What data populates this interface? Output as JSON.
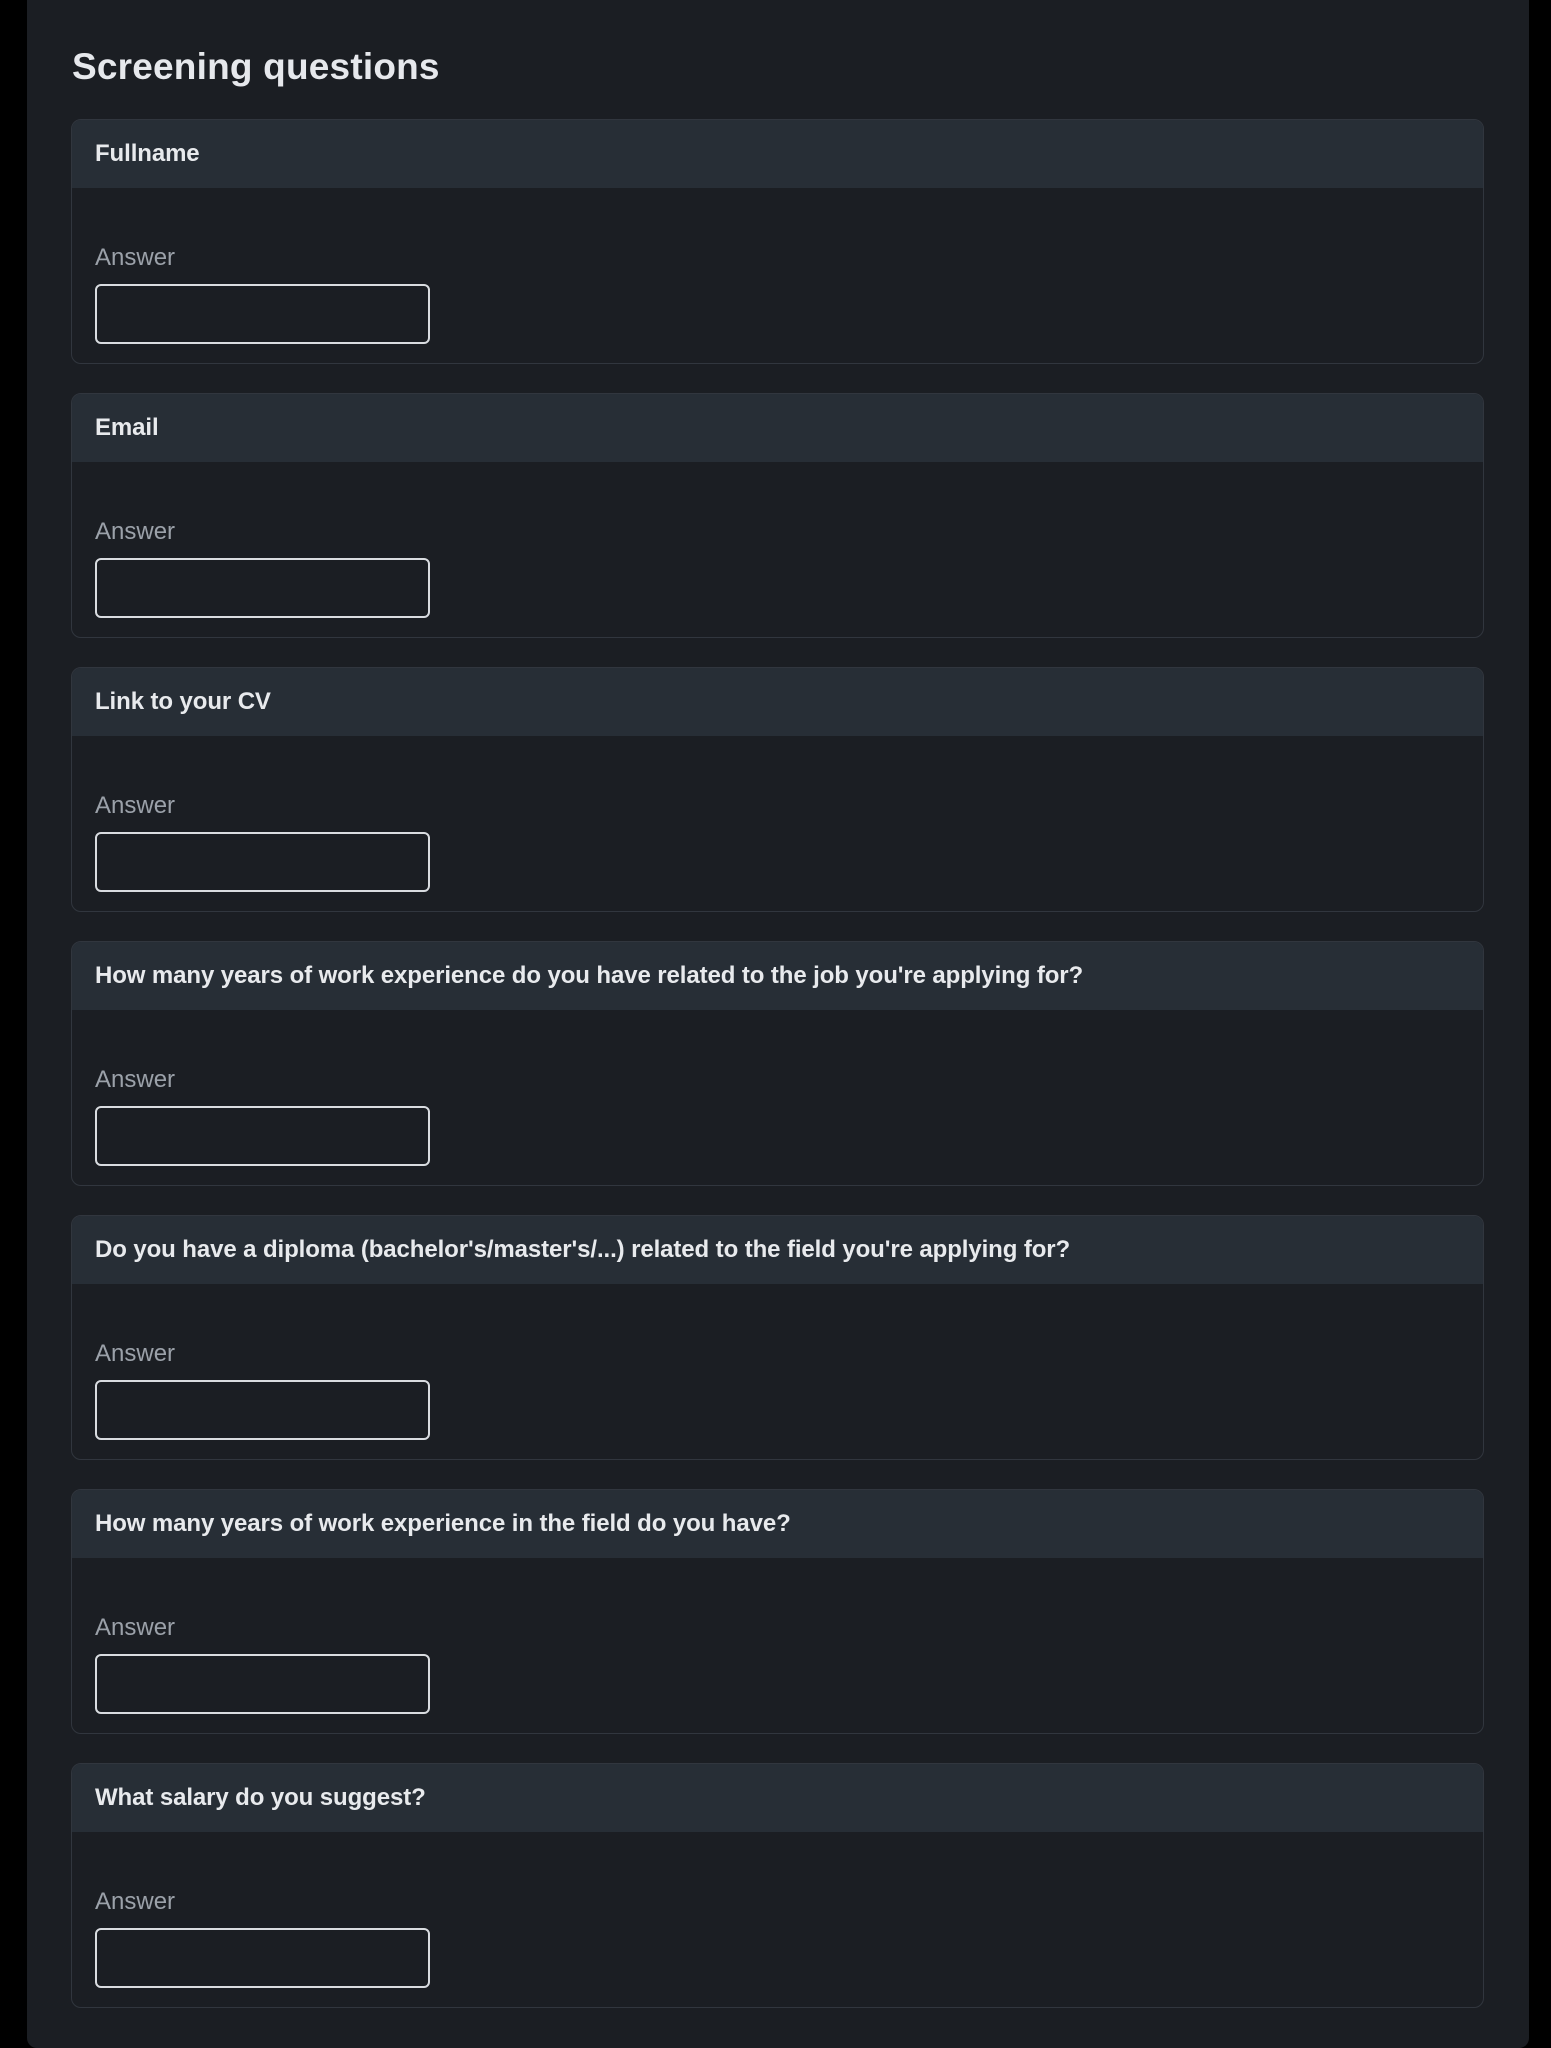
{
  "section_title": "Screening questions",
  "questions": [
    {
      "label": "Fullname",
      "answer_label": "Answer",
      "answer_value": ""
    },
    {
      "label": "Email",
      "answer_label": "Answer",
      "answer_value": ""
    },
    {
      "label": "Link to your CV",
      "answer_label": "Answer",
      "answer_value": ""
    },
    {
      "label": "How many years of work experience do you have related to the job you're applying for?",
      "answer_label": "Answer",
      "answer_value": ""
    },
    {
      "label": "Do you have a diploma (bachelor's/master's/...) related to the field you're applying for?",
      "answer_label": "Answer",
      "answer_value": ""
    },
    {
      "label": "How many years of work experience in the field do you have?",
      "answer_label": "Answer",
      "answer_value": ""
    },
    {
      "label": "What salary do you suggest?",
      "answer_label": "Answer",
      "answer_value": ""
    }
  ]
}
